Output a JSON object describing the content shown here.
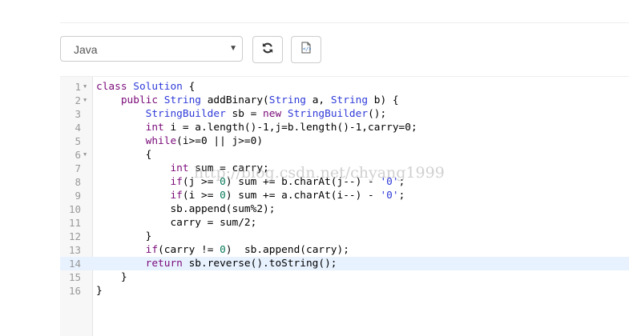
{
  "toolbar": {
    "language": "Java",
    "reset_icon": "refresh-icon",
    "file_icon": "code-file-icon"
  },
  "colors": {
    "keyword": "#7a0a78",
    "type": "#2f3bd8",
    "number": "#0b7a5a",
    "active_line": "#e8f2ff"
  },
  "editor": {
    "active_line": 14,
    "lines": [
      {
        "n": "1",
        "fold": true,
        "tokens": [
          [
            "keyword",
            "class"
          ],
          [
            "plain",
            " "
          ],
          [
            "type",
            "Solution"
          ],
          [
            "plain",
            " {"
          ]
        ]
      },
      {
        "n": "2",
        "fold": true,
        "tokens": [
          [
            "plain",
            "    "
          ],
          [
            "keyword",
            "public"
          ],
          [
            "plain",
            " "
          ],
          [
            "type",
            "String"
          ],
          [
            "plain",
            " addBinary("
          ],
          [
            "type",
            "String"
          ],
          [
            "plain",
            " a, "
          ],
          [
            "type",
            "String"
          ],
          [
            "plain",
            " b) {"
          ]
        ]
      },
      {
        "n": "3",
        "fold": false,
        "tokens": [
          [
            "plain",
            "        "
          ],
          [
            "type",
            "StringBuilder"
          ],
          [
            "plain",
            " sb = "
          ],
          [
            "keyword",
            "new"
          ],
          [
            "plain",
            " "
          ],
          [
            "type",
            "StringBuilder"
          ],
          [
            "plain",
            "();"
          ]
        ]
      },
      {
        "n": "4",
        "fold": false,
        "tokens": [
          [
            "plain",
            "        "
          ],
          [
            "keyword",
            "int"
          ],
          [
            "plain",
            " i = a.length()-1,j=b.length()-1,carry=0;"
          ]
        ]
      },
      {
        "n": "5",
        "fold": false,
        "tokens": [
          [
            "plain",
            "        "
          ],
          [
            "keyword",
            "while"
          ],
          [
            "plain",
            "(i>=0 || j>=0)"
          ]
        ]
      },
      {
        "n": "6",
        "fold": true,
        "tokens": [
          [
            "plain",
            "        {"
          ]
        ]
      },
      {
        "n": "7",
        "fold": false,
        "tokens": [
          [
            "plain",
            "            "
          ],
          [
            "keyword",
            "int"
          ],
          [
            "plain",
            " sum = carry;"
          ]
        ]
      },
      {
        "n": "8",
        "fold": false,
        "tokens": [
          [
            "plain",
            "            "
          ],
          [
            "keyword",
            "if"
          ],
          [
            "plain",
            "(j >= "
          ],
          [
            "number",
            "0"
          ],
          [
            "plain",
            ") sum += b.charAt(j--) - "
          ],
          [
            "string",
            "'0'"
          ],
          [
            "plain",
            ";"
          ]
        ]
      },
      {
        "n": "9",
        "fold": false,
        "tokens": [
          [
            "plain",
            "            "
          ],
          [
            "keyword",
            "if"
          ],
          [
            "plain",
            "(i >= "
          ],
          [
            "number",
            "0"
          ],
          [
            "plain",
            ") sum += a.charAt(i--) - "
          ],
          [
            "string",
            "'0'"
          ],
          [
            "plain",
            ";"
          ]
        ]
      },
      {
        "n": "10",
        "fold": false,
        "tokens": [
          [
            "plain",
            "            sb.append(sum%2);"
          ]
        ]
      },
      {
        "n": "11",
        "fold": false,
        "tokens": [
          [
            "plain",
            "            carry = sum/2;"
          ]
        ]
      },
      {
        "n": "12",
        "fold": false,
        "tokens": [
          [
            "plain",
            "        }"
          ]
        ]
      },
      {
        "n": "13",
        "fold": false,
        "tokens": [
          [
            "plain",
            "        "
          ],
          [
            "keyword",
            "if"
          ],
          [
            "plain",
            "(carry != "
          ],
          [
            "number",
            "0"
          ],
          [
            "plain",
            ")  sb.append(carry);"
          ]
        ]
      },
      {
        "n": "14",
        "fold": false,
        "tokens": [
          [
            "plain",
            "        "
          ],
          [
            "keyword",
            "return"
          ],
          [
            "plain",
            " sb.reverse().toString();"
          ]
        ]
      },
      {
        "n": "15",
        "fold": false,
        "tokens": [
          [
            "plain",
            "    }"
          ]
        ]
      },
      {
        "n": "16",
        "fold": false,
        "tokens": [
          [
            "plain",
            "}"
          ]
        ]
      }
    ]
  },
  "watermark": "http://blog.csdn.net/chyang1999"
}
